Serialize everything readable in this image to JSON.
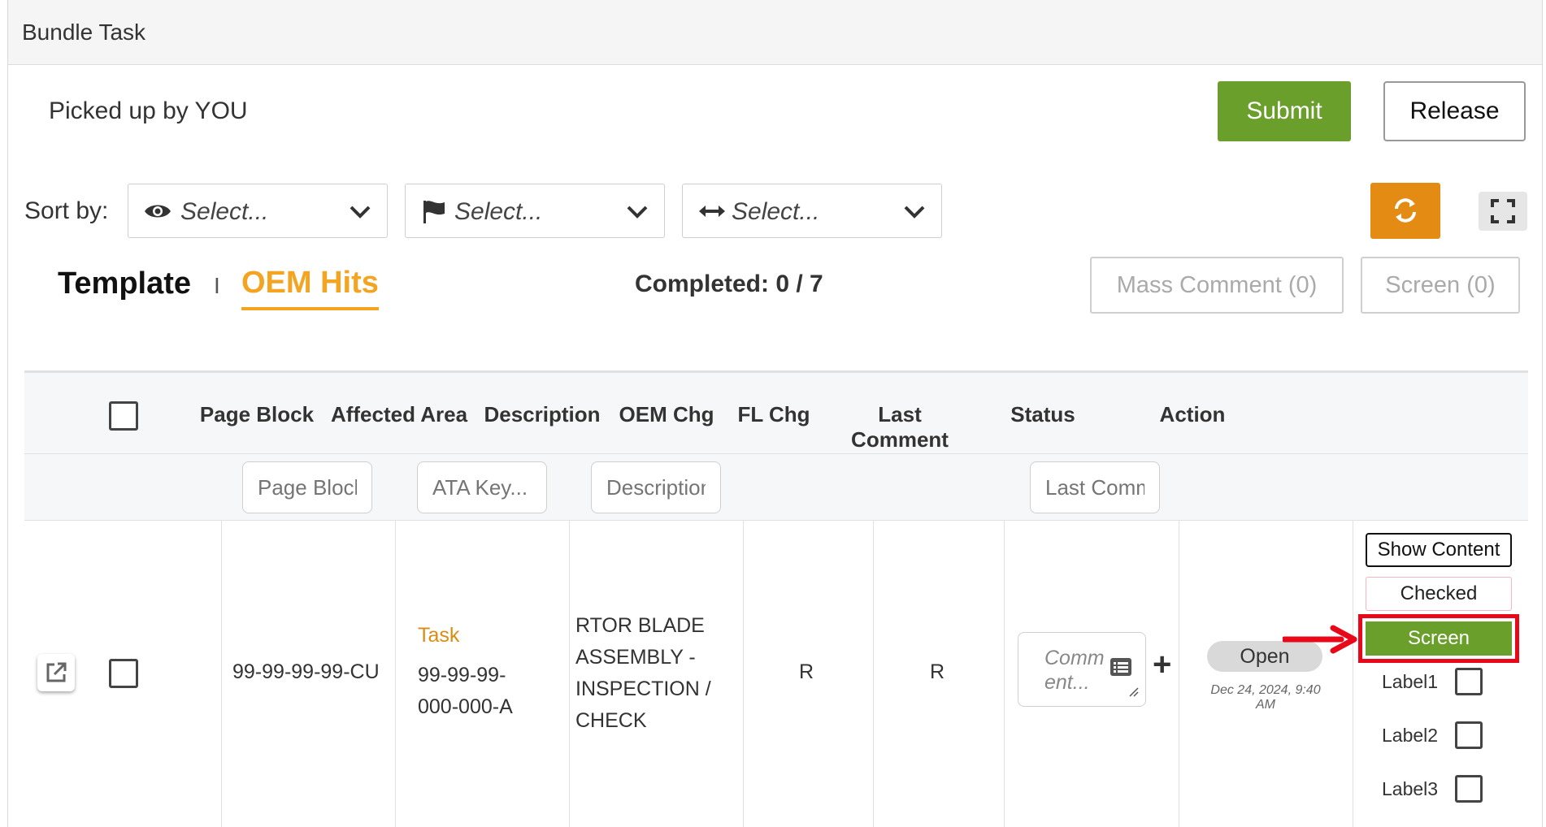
{
  "panel": {
    "title": "Bundle Task"
  },
  "pickup": {
    "text": "Picked up by YOU"
  },
  "actions": {
    "submit_label": "Submit",
    "release_label": "Release"
  },
  "sort": {
    "label": "Sort by:",
    "selects": [
      {
        "icon": "eye-icon",
        "placeholder": "Select..."
      },
      {
        "icon": "flag-icon",
        "placeholder": "Select..."
      },
      {
        "icon": "arrows-horizontal-icon",
        "placeholder": "Select..."
      }
    ]
  },
  "tabs": {
    "template": "Template",
    "separator": "I",
    "oem_hits": "OEM Hits"
  },
  "progress": {
    "completed_text": "Completed: 0 / 7"
  },
  "bulk": {
    "mass_comment_label": "Mass Comment (0)",
    "screen_label": "Screen (0)"
  },
  "table": {
    "columns": [
      "Page Block",
      "Affected Area",
      "Description",
      "OEM Chg",
      "FL Chg",
      "Last Comment",
      "Status",
      "Action"
    ],
    "filters": {
      "page_block": "Page Block",
      "affected_area": "ATA Key...",
      "description": "Description",
      "last_comment": "Last Comm"
    },
    "rows": [
      {
        "page_block": "99-99-99-99-CU",
        "affected_area_type": "Task",
        "affected_area_code": "99-99-99-000-000-A",
        "description": "RTOR BLADE ASSEMBLY - INSPECTION / CHECK",
        "oem_chg": "R",
        "fl_chg": "R",
        "comment_placeholder": "Comment...",
        "status": "Open",
        "status_date": "Dec 24, 2024, 9:40 AM",
        "action_show": "Show Content",
        "action_checked": "Checked",
        "action_screen": "Screen",
        "labels": [
          "Label1",
          "Label2",
          "Label3"
        ]
      }
    ]
  },
  "colors": {
    "accent_orange": "#f3a521",
    "green": "#6a9f2c",
    "refresh_orange": "#e38b13",
    "highlight_red": "#e8081a"
  }
}
